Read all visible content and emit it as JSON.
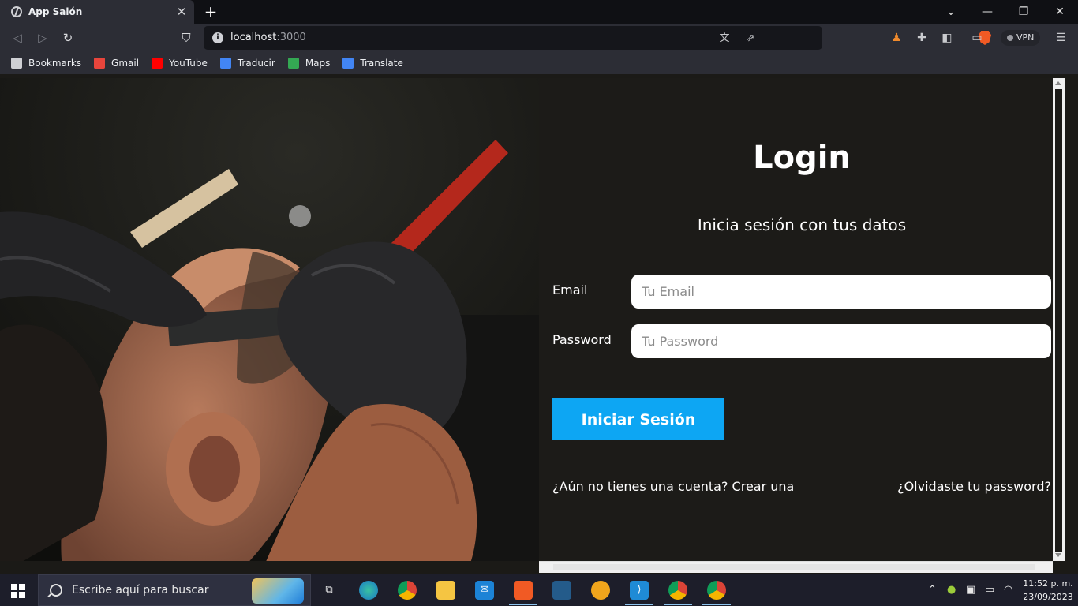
{
  "browser": {
    "tab_title": "App Salón",
    "tab_close": "✕",
    "new_tab": "+",
    "window_controls": {
      "minimize": "—",
      "restore": "❐",
      "close": "✕",
      "tab_list": "⌄"
    },
    "url_host": "localhost",
    "url_port": ":3000",
    "vpn_label": "VPN",
    "bookmarks": [
      {
        "label": "Bookmarks",
        "icon": "bookmarks-icon",
        "color": "#cfd0d4"
      },
      {
        "label": "Gmail",
        "icon": "gmail-icon",
        "color": "#e8453c"
      },
      {
        "label": "YouTube",
        "icon": "youtube-icon",
        "color": "#ff0000"
      },
      {
        "label": "Traducir",
        "icon": "google-translate-icon",
        "color": "#4285f4"
      },
      {
        "label": "Maps",
        "icon": "maps-icon",
        "color": "#34a853"
      },
      {
        "label": "Translate",
        "icon": "google-translate-icon",
        "color": "#4285f4"
      }
    ]
  },
  "page": {
    "title": "Login",
    "subtitle": "Inicia sesión con tus datos",
    "email_label": "Email",
    "email_placeholder": "Tu Email",
    "password_label": "Password",
    "password_placeholder": "Tu Password",
    "submit_label": "Iniciar Sesión",
    "create_account_link": "¿Aún no tienes una cuenta? Crear una",
    "forgot_password_link": "¿Olvidaste tu password?",
    "accent_color": "#0da6f3",
    "background_color": "#1c1b18"
  },
  "taskbar": {
    "search_placeholder": "Escribe aquí para buscar",
    "time": "11:52 p. m.",
    "date": "23/09/2023",
    "apps": [
      "task-view-icon",
      "edge-icon",
      "chrome-icon",
      "file-explorer-icon",
      "mail-icon",
      "brave-icon",
      "mysql-workbench-icon",
      "tableplus-icon",
      "vscode-icon",
      "chrome-profile-icon",
      "chrome-profile-icon"
    ]
  }
}
